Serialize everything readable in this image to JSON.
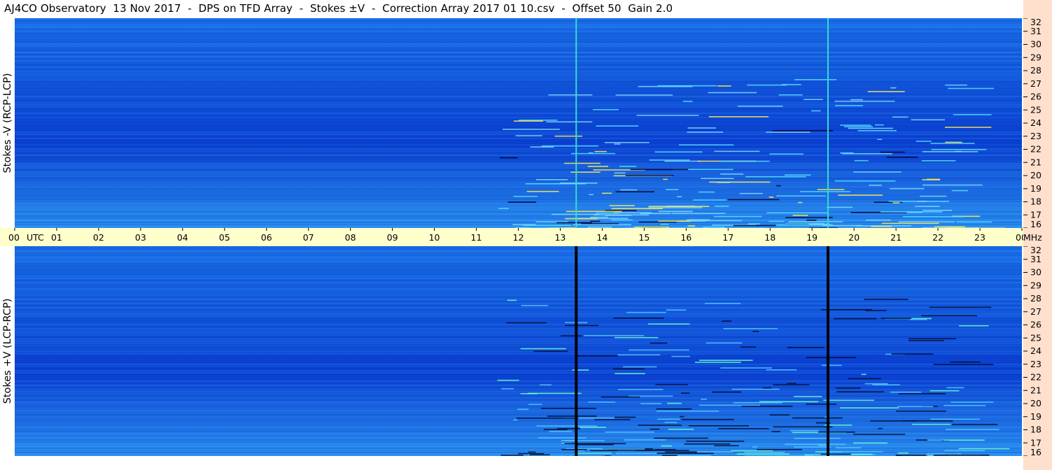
{
  "title": "AJ4CO Observatory  13 Nov 2017  -  DPS on TFD Array  -  Stokes ±V  -  Correction Array 2017 01 10.csv  -  Offset 50  Gain 2.0",
  "colors": {
    "background_blue": "#1a6ee6",
    "dark_blue": "#0a3fd0",
    "light_blue": "#2a90f0",
    "time_axis_bg": "#ffffcc",
    "freq_axis_bg": "#ffe0cc"
  },
  "chart_data": {
    "type": "heatmap",
    "panels": [
      {
        "label": "Stokes -V (RCP-LCP)",
        "polarity": "minus"
      },
      {
        "label": "Stokes +V (LCP-RCP)",
        "polarity": "plus"
      }
    ],
    "x": {
      "unit_label": "UTC",
      "tick_labels": [
        "00",
        "01",
        "02",
        "03",
        "04",
        "05",
        "06",
        "07",
        "08",
        "09",
        "10",
        "11",
        "12",
        "13",
        "14",
        "15",
        "16",
        "17",
        "18",
        "19",
        "20",
        "21",
        "22",
        "23",
        "00"
      ],
      "range": [
        0,
        24
      ]
    },
    "y": {
      "unit_label": "MHz",
      "tick_labels": [
        "16",
        "17",
        "18",
        "19",
        "20",
        "21",
        "22",
        "23",
        "24",
        "25",
        "26",
        "27",
        "28",
        "29",
        "30",
        "31",
        "32"
      ],
      "range": [
        16,
        32
      ]
    },
    "vertical_lines_utc": [
      13.38,
      19.38
    ]
  }
}
